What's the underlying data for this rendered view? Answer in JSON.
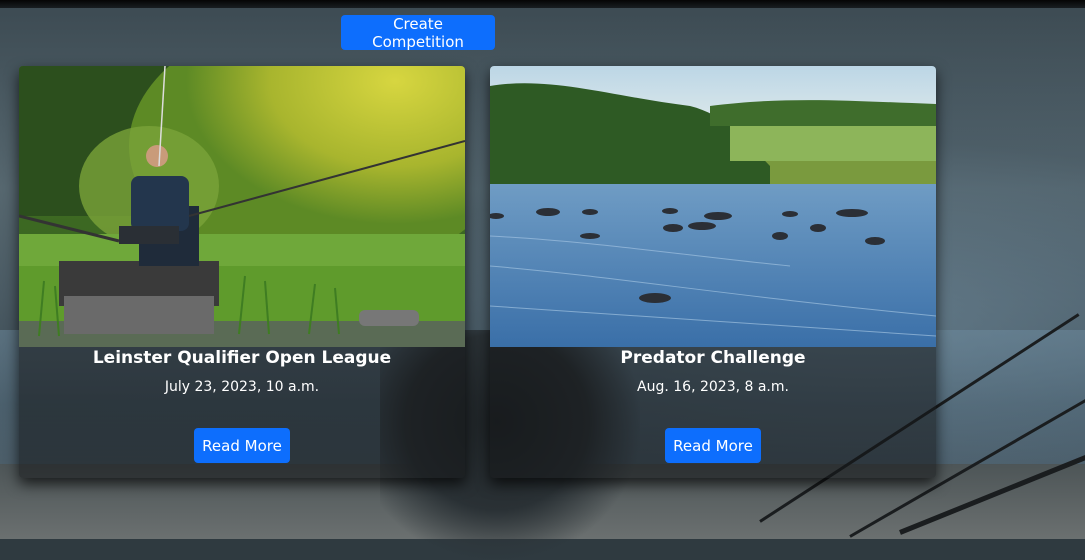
{
  "header": {
    "create_button_label": "Create Competition"
  },
  "competitions": [
    {
      "title": "Leinster Qualifier Open League",
      "date": "July 23, 2023, 10 a.m.",
      "read_more_label": "Read More",
      "image_subject": "angler-on-riverbank-photo"
    },
    {
      "title": "Predator Challenge",
      "date": "Aug. 16, 2023, 8 a.m.",
      "read_more_label": "Read More",
      "image_subject": "boats-on-lake-photo"
    }
  ],
  "colors": {
    "primary_button": "#0d6efd",
    "button_text": "#ffffff",
    "card_text": "#ffffff"
  }
}
